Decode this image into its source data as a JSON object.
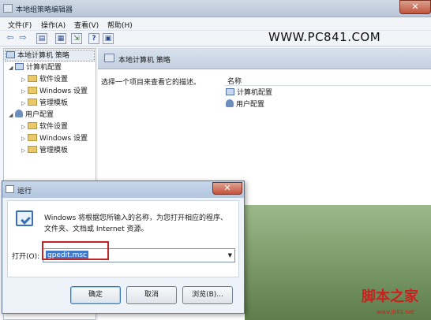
{
  "gpe": {
    "title": "本地组策略编辑器",
    "menu": [
      "文件(F)",
      "操作(A)",
      "查看(V)",
      "帮助(H)"
    ],
    "watermark": "WWW.PC841.COM",
    "tree": {
      "root": "本地计算机 策略",
      "computer": "计算机配置",
      "computer_children": [
        "软件设置",
        "Windows 设置",
        "管理模板"
      ],
      "user": "用户配置",
      "user_children": [
        "软件设置",
        "Windows 设置",
        "管理模板"
      ]
    },
    "right_header": "本地计算机 策略",
    "description_hint": "选择一个项目来查看它的描述。",
    "list_header": "名称",
    "list_items": [
      "计算机配置",
      "用户配置"
    ]
  },
  "run": {
    "title": "运行",
    "description": "Windows 将根据您所输入的名称，为您打开相应的程序、文件夹、文档或 Internet 资源。",
    "open_label": "打开(O):",
    "open_value": "gpedit.msc",
    "ok_label": "确定",
    "cancel_label": "取消",
    "browse_label": "浏览(B)..."
  },
  "logo": {
    "text": "脚本之家",
    "sub": "www.jb51.net"
  },
  "colors": {
    "selection": "#3e78c6",
    "highlight_box": "#c52424",
    "folder": "#e9c969",
    "logo_red": "#c8221f"
  }
}
